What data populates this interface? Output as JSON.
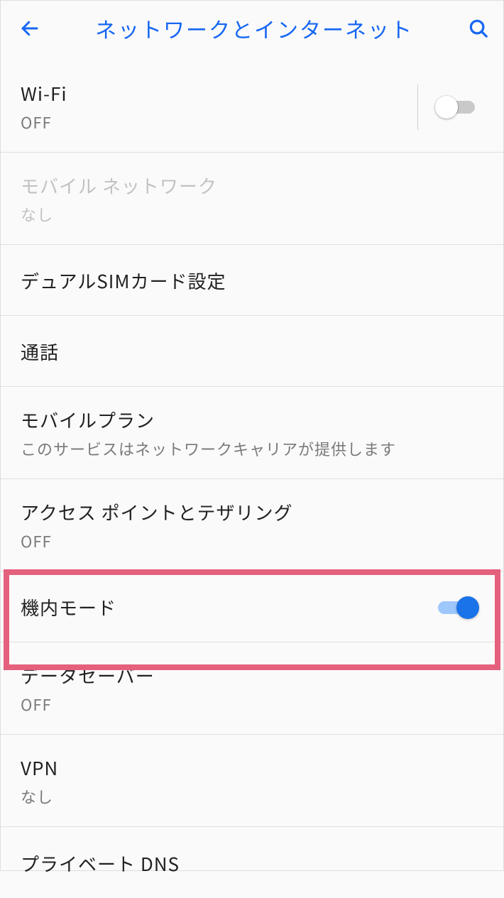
{
  "header": {
    "title": "ネットワークとインターネット"
  },
  "colors": {
    "accent": "#1767f3",
    "highlight": "#e4607d",
    "switch_on": "#1a73e8",
    "switch_on_track": "#9ec7fb"
  },
  "items": {
    "wifi": {
      "title": "Wi-Fi",
      "subtitle": "OFF",
      "toggle": {
        "on": false
      }
    },
    "mobile_net": {
      "title": "モバイル ネットワーク",
      "subtitle": "なし",
      "disabled": true
    },
    "dual_sim": {
      "title": "デュアルSIMカード設定"
    },
    "call": {
      "title": "通話"
    },
    "mobile_plan": {
      "title": "モバイルプラン",
      "subtitle": "このサービスはネットワークキャリアが提供します"
    },
    "tethering": {
      "title": "アクセス ポイントとテザリング",
      "subtitle": "OFF"
    },
    "airplane": {
      "title": "機内モード",
      "toggle": {
        "on": true
      },
      "highlighted": true
    },
    "data_saver": {
      "title": "データセーバー",
      "subtitle": "OFF"
    },
    "vpn": {
      "title": "VPN",
      "subtitle": "なし"
    },
    "private_dns": {
      "title": "プライベート DNS"
    }
  }
}
